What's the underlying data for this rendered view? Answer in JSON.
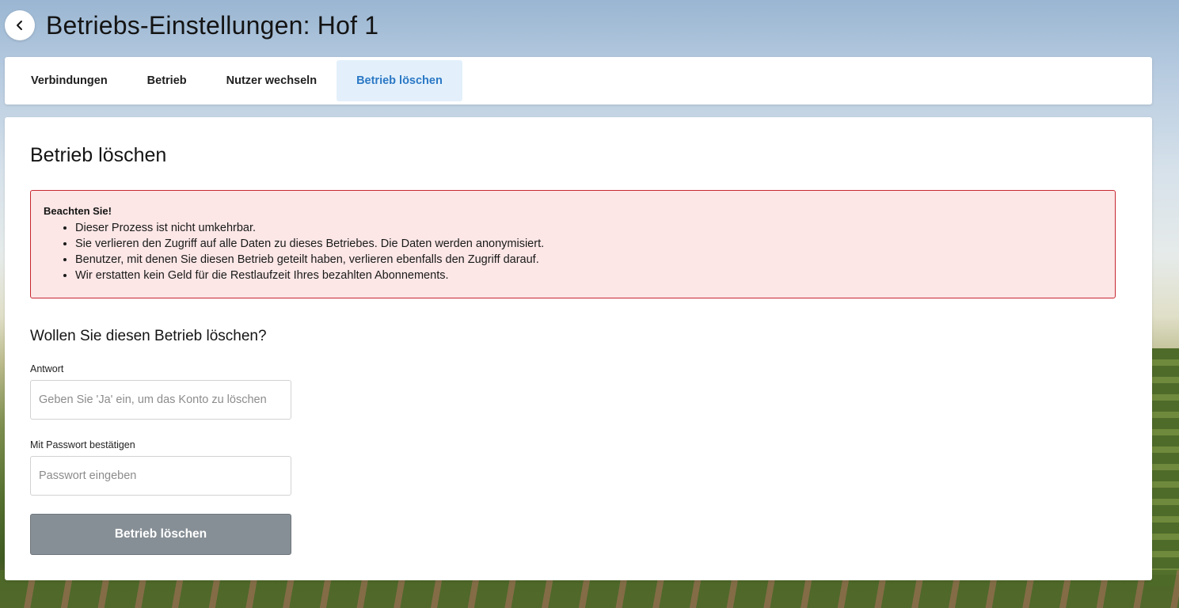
{
  "header": {
    "back_icon": "chevron-left-icon",
    "title": "Betriebs-Einstellungen: Hof 1"
  },
  "tabs": [
    {
      "label": "Verbindungen",
      "active": false
    },
    {
      "label": "Betrieb",
      "active": false
    },
    {
      "label": "Nutzer wechseln",
      "active": false
    },
    {
      "label": "Betrieb löschen",
      "active": true
    }
  ],
  "main": {
    "title": "Betrieb löschen",
    "warning": {
      "title": "Beachten Sie!",
      "items": [
        "Dieser Prozess ist nicht umkehrbar.",
        "Sie verlieren den Zugriff auf alle Daten zu dieses Betriebes. Die Daten werden anonymisiert.",
        "Benutzer, mit denen Sie diesen Betrieb geteilt haben, verlieren ebenfalls den Zugriff darauf.",
        "Wir erstatten kein Geld für die Restlaufzeit Ihres bezahlten Abonnements."
      ]
    },
    "question": "Wollen Sie diesen Betrieb löschen?",
    "answer_field": {
      "label": "Antwort",
      "value": "",
      "placeholder": "Geben Sie 'Ja' ein, um das Konto zu löschen"
    },
    "password_field": {
      "label": "Mit Passwort bestätigen",
      "value": "",
      "placeholder": "Passwort eingeben"
    },
    "submit_label": "Betrieb löschen"
  },
  "colors": {
    "active_tab_bg": "#e3f0fb",
    "active_tab_text": "#2b78c5",
    "warning_bg": "#fce6e6",
    "warning_border": "#c8262f",
    "button_disabled": "#878f96"
  }
}
